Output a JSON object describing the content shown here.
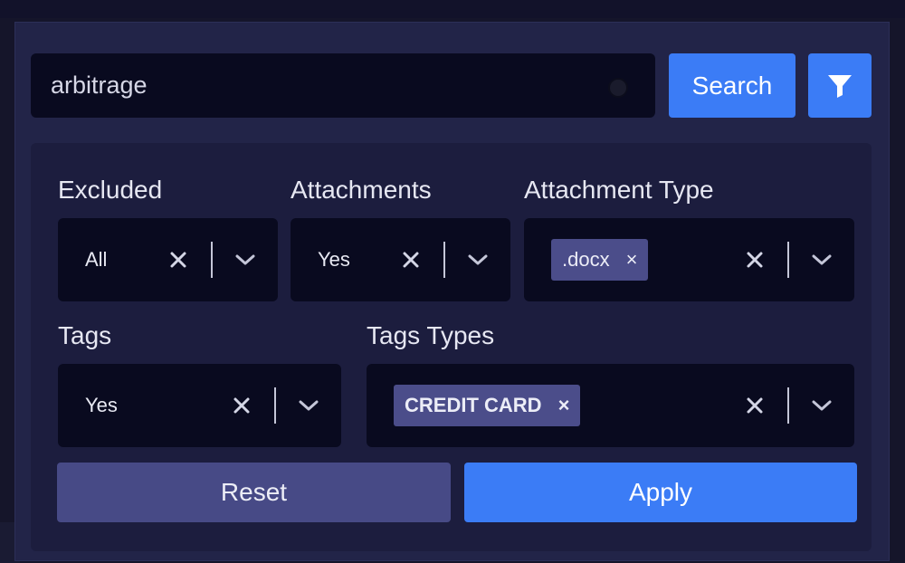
{
  "search": {
    "value": "arbitrage",
    "button_label": "Search",
    "filter_icon": "filter-icon"
  },
  "filters": {
    "excluded": {
      "label": "Excluded",
      "value": "All"
    },
    "attachments": {
      "label": "Attachments",
      "value": "Yes"
    },
    "attachment_type": {
      "label": "Attachment Type",
      "chips": [
        ".docx"
      ]
    },
    "tags": {
      "label": "Tags",
      "value": "Yes"
    },
    "tags_types": {
      "label": "Tags Types",
      "chips": [
        "CREDIT CARD"
      ]
    },
    "chip_remove_glyph": "×"
  },
  "actions": {
    "reset_label": "Reset",
    "apply_label": "Apply"
  },
  "colors": {
    "accent": "#3b7cf6",
    "secondary": "#474a86",
    "panel": "#222448",
    "field_bg": "#090a1f"
  }
}
